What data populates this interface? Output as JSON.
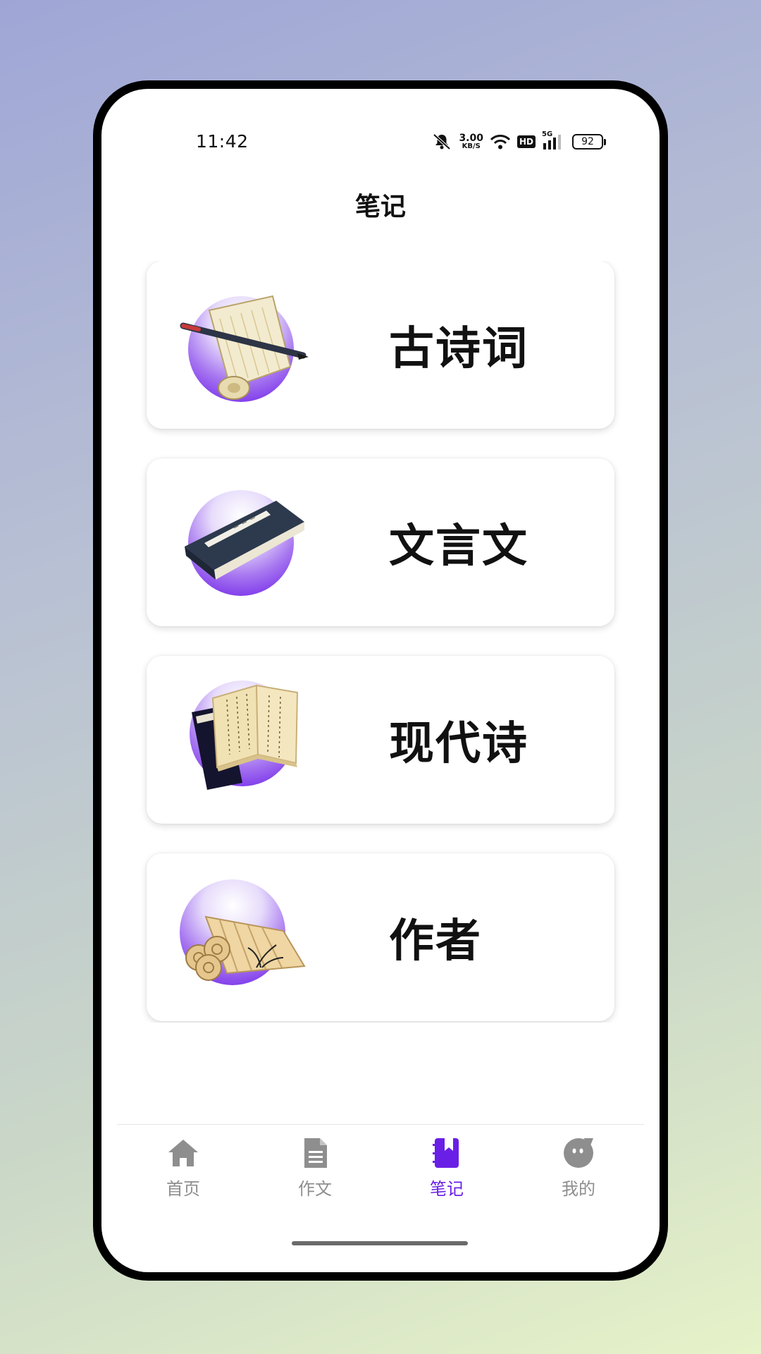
{
  "status_bar": {
    "time": "11:42",
    "net_speed_value": "3.00",
    "net_speed_unit": "KB/S",
    "hd_label": "HD",
    "network_type": "5G",
    "battery_level": "92",
    "icons": [
      "mute-bell-icon",
      "wifi-icon",
      "signal-icon",
      "battery-icon"
    ]
  },
  "header": {
    "title": "笔记"
  },
  "notes": {
    "items": [
      {
        "label": "古诗词",
        "icon": "scroll-brush-icon"
      },
      {
        "label": "文言文",
        "icon": "thread-bound-book-icon"
      },
      {
        "label": "现代诗",
        "icon": "open-books-icon"
      },
      {
        "label": "作者",
        "icon": "bamboo-slips-icon"
      }
    ]
  },
  "tabbar": {
    "active_color": "#6a1fe6",
    "inactive_color": "#8e8e8e",
    "items": [
      {
        "label": "首页",
        "icon": "home-icon",
        "active": false
      },
      {
        "label": "作文",
        "icon": "document-icon",
        "active": false
      },
      {
        "label": "笔记",
        "icon": "notebook-icon",
        "active": true
      },
      {
        "label": "我的",
        "icon": "profile-icon",
        "active": false
      }
    ]
  }
}
